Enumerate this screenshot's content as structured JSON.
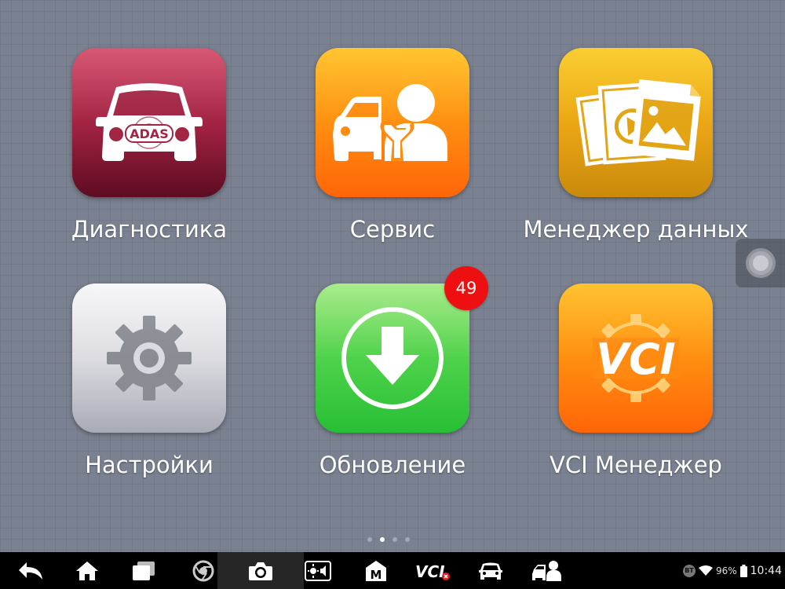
{
  "apps": [
    {
      "id": "diagnostics",
      "label": "Диагностика",
      "icon": "car-adas-icon",
      "icon_text": "ADAS"
    },
    {
      "id": "service",
      "label": "Сервис",
      "icon": "car-mechanic-icon"
    },
    {
      "id": "data-manager",
      "label": "Менеджер данных",
      "icon": "media-files-icon"
    },
    {
      "id": "settings",
      "label": "Настройки",
      "icon": "gear-icon"
    },
    {
      "id": "update",
      "label": "Обновление",
      "icon": "download-arrow-icon",
      "badge": "49"
    },
    {
      "id": "vci-manager",
      "label": "VCI Менеджер",
      "icon": "vci-gear-icon",
      "icon_text": "VCI"
    }
  ],
  "pager": {
    "pages": 4,
    "active": 1
  },
  "navbar": {
    "buttons": [
      "back-icon",
      "home-icon",
      "recent-apps-icon",
      "chrome-icon",
      "camera-icon",
      "display-volume-icon",
      "m-logo-icon",
      "vci-status-icon",
      "car-icon",
      "car-mechanic-icon"
    ],
    "vci_text": "VCI",
    "m_text": "M"
  },
  "status": {
    "bt": "BT",
    "battery": "96%",
    "time": "10:44"
  },
  "colors": {
    "background": "#7a8190",
    "badge": "#ee1010",
    "navbar": "#000000"
  }
}
